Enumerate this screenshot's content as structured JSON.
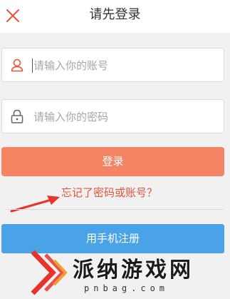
{
  "header": {
    "title": "请先登录",
    "close_icon": "close-icon"
  },
  "form": {
    "account_placeholder": "请输入你的账号",
    "password_placeholder": "请输入你的密码",
    "account_icon": "user-icon",
    "password_icon": "lock-icon"
  },
  "actions": {
    "login_label": "登录",
    "forgot_label": "忘记了密码或账号？",
    "register_label": "用手机注册"
  },
  "watermark": {
    "name": "派纳游戏网",
    "domain": "pnbag.com"
  },
  "colors": {
    "accent": "#e5543c",
    "login_button": "#f58465",
    "register_button": "#4aa3e6",
    "background": "#f1f1f1"
  }
}
